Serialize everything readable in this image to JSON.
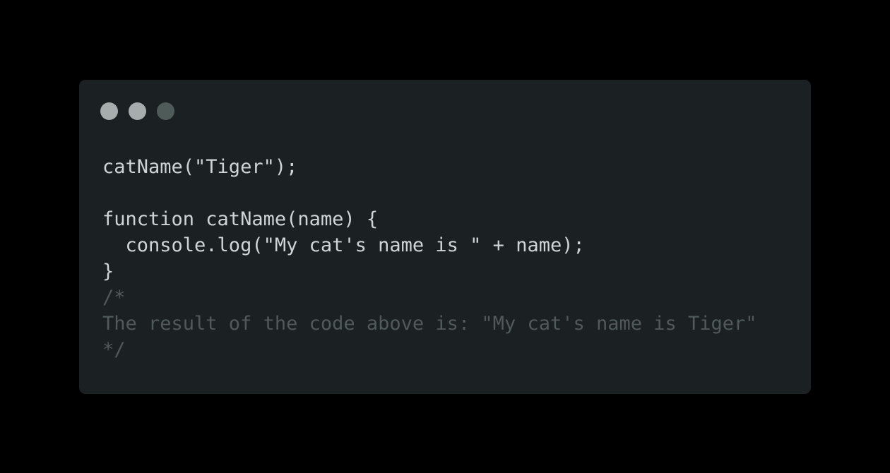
{
  "window": {
    "background": "#1b2022",
    "controls": [
      {
        "name": "close",
        "color": "#a7acad"
      },
      {
        "name": "minimize",
        "color": "#a7acad"
      },
      {
        "name": "maximize",
        "color": "#4f5b58"
      }
    ]
  },
  "code": {
    "language": "javascript",
    "text_color": "#cfd5d6",
    "comment_color": "#505a59",
    "lines": [
      "catName(\"Tiger\");",
      "",
      "function catName(name) {",
      "  console.log(\"My cat's name is \" + name);",
      "}",
      "/*",
      "The result of the code above is: \"My cat's name is Tiger\"",
      "*/"
    ]
  }
}
